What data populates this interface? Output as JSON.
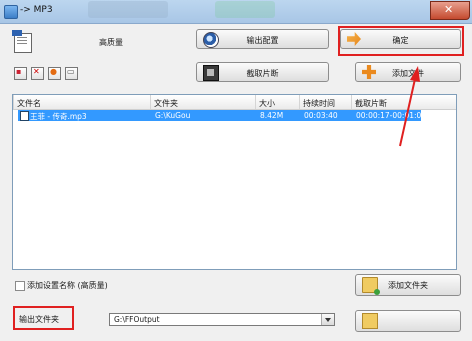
{
  "window": {
    "title": "-> MP3"
  },
  "header": {
    "quality": "高质量"
  },
  "buttons": {
    "output_config": "输出配置",
    "ok": "确定",
    "clip": "截取片断",
    "add_file": "添加文件",
    "add_folder": "添加文件夹"
  },
  "toolbar": {
    "icons": [
      "add-icon",
      "delete-icon",
      "play-icon",
      "settings-icon"
    ]
  },
  "file_list": {
    "columns": [
      "文件名",
      "文件夹",
      "大小",
      "持续时间",
      "截取片断"
    ],
    "rows": [
      {
        "name": "王菲 - 传奇.mp3",
        "folder": "G:\\KuGou",
        "size": "8.42M",
        "duration": "00:03:40",
        "clip": "00:00:17-00:01:08",
        "selected": true
      }
    ]
  },
  "options": {
    "add_setting_name": "添加设置名称 (高质量)",
    "add_setting_checked": false
  },
  "output": {
    "label": "输出文件夹",
    "path": "G:\\FFOutput"
  },
  "colors": {
    "annotation": "#e02020",
    "selection": "#3399ff"
  }
}
